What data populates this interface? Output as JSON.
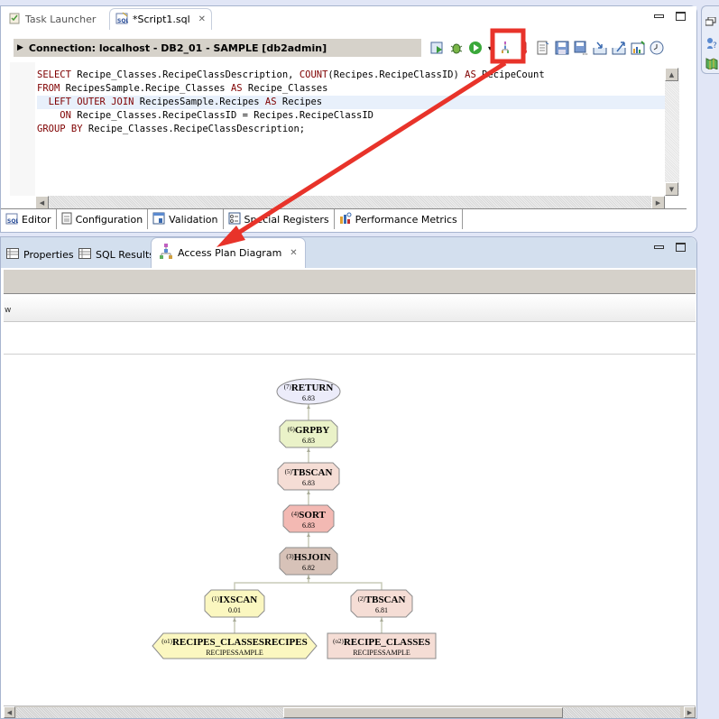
{
  "editor": {
    "tabs": [
      {
        "label": "Task Launcher",
        "icon": "task-launcher-icon",
        "active": false
      },
      {
        "label": "*Script1.sql",
        "icon": "sql-file-icon",
        "active": true,
        "closable": true
      }
    ],
    "connection": "Connection: localhost - DB2_01 - SAMPLE [db2admin]",
    "toolbar_icons": [
      "run-sql-file-icon",
      "debug-bug-icon",
      "run-green-icon",
      "dropdown-arrow-icon",
      "visual-explain-icon",
      "thermometer-icon",
      "script-properties-icon",
      "save-icon",
      "save-as-icon",
      "import-icon",
      "export-icon",
      "chart-icon",
      "history-clock-icon"
    ],
    "sql": [
      [
        {
          "t": "SELECT",
          "k": true
        },
        {
          "t": " Recipe_Classes.RecipeClassDescription, "
        },
        {
          "t": "COUNT",
          "k": true
        },
        {
          "t": "(Recipes.RecipeClassID) "
        },
        {
          "t": "AS",
          "k": true
        },
        {
          "t": " RecipeCount"
        }
      ],
      [
        {
          "t": "FROM",
          "k": true
        },
        {
          "t": " RecipesSample.Recipe_Classes "
        },
        {
          "t": "AS",
          "k": true
        },
        {
          "t": " Recipe_Classes"
        }
      ],
      [
        {
          "t": "  "
        },
        {
          "t": "LEFT OUTER JOIN",
          "k": true
        },
        {
          "t": " RecipesSample.Recipes "
        },
        {
          "t": "AS",
          "k": true
        },
        {
          "t": " Recipes"
        }
      ],
      [
        {
          "t": "    "
        },
        {
          "t": "ON",
          "k": true
        },
        {
          "t": " Recipe_Classes.RecipeClassID = Recipes.RecipeClassID"
        }
      ],
      [
        {
          "t": "GROUP BY",
          "k": true
        },
        {
          "t": " Recipe_Classes.RecipeClassDescription;"
        }
      ]
    ],
    "highlighted_line": 2,
    "subtabs": [
      {
        "label": "Editor",
        "icon": "sql-editor-icon",
        "active": true
      },
      {
        "label": "Configuration",
        "icon": "document-icon"
      },
      {
        "label": "Validation",
        "icon": "validation-icon"
      },
      {
        "label": "Special Registers",
        "icon": "registers-icon"
      },
      {
        "label": "Performance Metrics",
        "icon": "metrics-icon"
      }
    ]
  },
  "bottom": {
    "tabs": [
      {
        "label": "Properties",
        "icon": "table-icon"
      },
      {
        "label": "SQL Results",
        "icon": "table-icon"
      },
      {
        "label": "Access Plan Diagram",
        "icon": "diagram-icon",
        "active": true,
        "closable": true
      }
    ],
    "overview_text": "w"
  },
  "access_plan": {
    "nodes": [
      {
        "id": "7",
        "op": "RETURN",
        "cost": "6.83",
        "shape": "ellipse",
        "fill": "#ececfa"
      },
      {
        "id": "6",
        "op": "GRPBY",
        "cost": "6.83",
        "shape": "octagon",
        "fill": "#eaf2c8"
      },
      {
        "id": "5",
        "op": "TBSCAN",
        "cost": "6.83",
        "shape": "octagon",
        "fill": "#f5ddd5"
      },
      {
        "id": "4",
        "op": "SORT",
        "cost": "6.83",
        "shape": "octagon",
        "fill": "#f3b9b3"
      },
      {
        "id": "3",
        "op": "HSJOIN",
        "cost": "6.82",
        "shape": "octagon",
        "fill": "#d7c2b8"
      },
      {
        "id": "1",
        "op": "IXSCAN",
        "cost": "0.01",
        "shape": "octagon",
        "fill": "#fbf7c0"
      },
      {
        "id": "2",
        "op": "TBSCAN",
        "cost": "6.81",
        "shape": "octagon",
        "fill": "#f5ddd5"
      },
      {
        "id": "o1",
        "op": "RECIPES_CLASSESRECIPES",
        "cost": "RECIPESSAMPLE",
        "shape": "hexagon",
        "fill": "#fbf7c0"
      },
      {
        "id": "o2",
        "op": "RECIPE_CLASSES",
        "cost": "RECIPESSAMPLE",
        "shape": "rect",
        "fill": "#f5ddd5"
      }
    ],
    "edges": [
      [
        "6",
        "7"
      ],
      [
        "5",
        "6"
      ],
      [
        "4",
        "5"
      ],
      [
        "3",
        "4"
      ],
      [
        "1",
        "3"
      ],
      [
        "2",
        "3"
      ],
      [
        "o1",
        "1"
      ],
      [
        "o2",
        "2"
      ]
    ]
  },
  "annotation": {
    "color": "#e8332a",
    "highlighted_toolbar_icon": "visual-explain-icon",
    "points_to": "Access Plan Diagram"
  }
}
